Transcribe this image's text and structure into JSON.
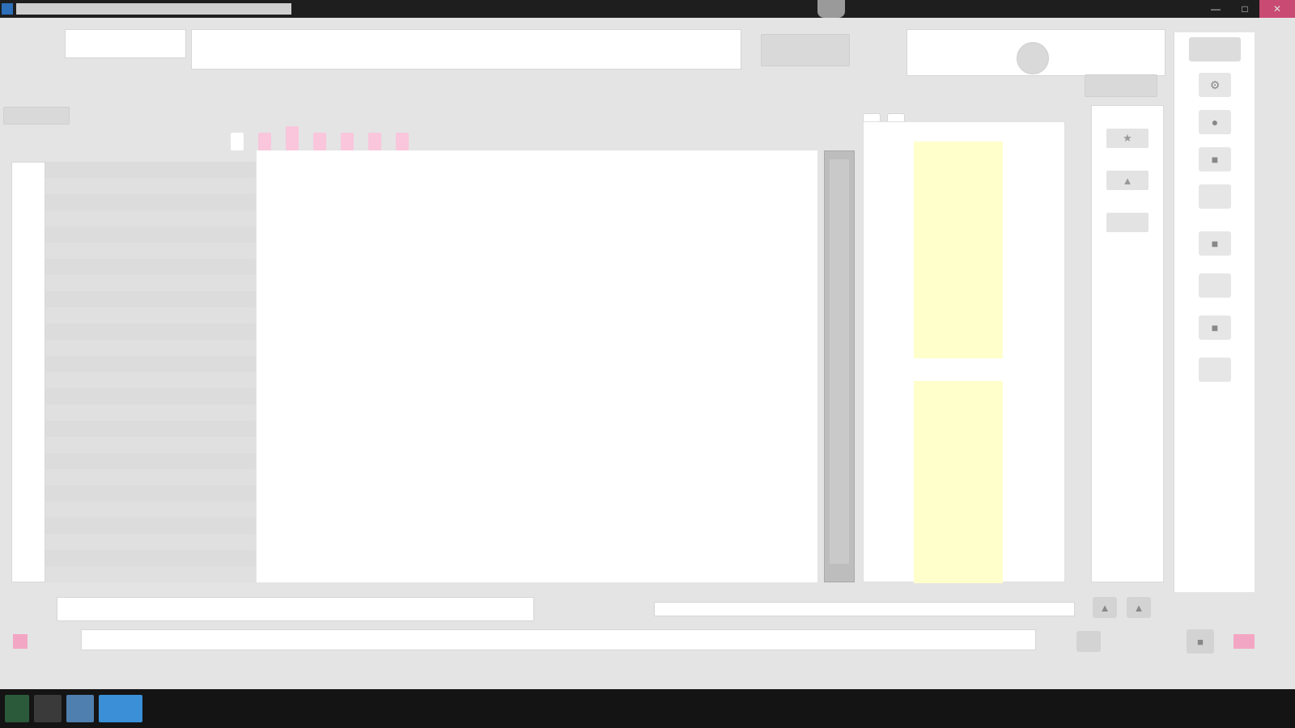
{
  "window": {
    "title": "",
    "buttons": {
      "minimize": "—",
      "maximize": "□",
      "close": "✕"
    }
  },
  "toolbar": {
    "fields": [
      "",
      "",
      ""
    ],
    "buttons": [
      "",
      "",
      ""
    ]
  },
  "tabs": [
    {
      "label": "",
      "active": true
    },
    {
      "label": "",
      "active": false
    },
    {
      "label": "",
      "active": false
    },
    {
      "label": "",
      "active": false
    },
    {
      "label": "",
      "active": false
    },
    {
      "label": "",
      "active": false
    },
    {
      "label": "",
      "active": false
    }
  ],
  "right_tabs": [
    "",
    ""
  ],
  "icons": {
    "gear": "⚙",
    "star": "★",
    "triangle": "▲",
    "square": "■",
    "circle": "●"
  },
  "colors": {
    "accent_pink": "#f9c6dc",
    "note_yellow": "#ffffcc",
    "taskbar": "#141414"
  }
}
